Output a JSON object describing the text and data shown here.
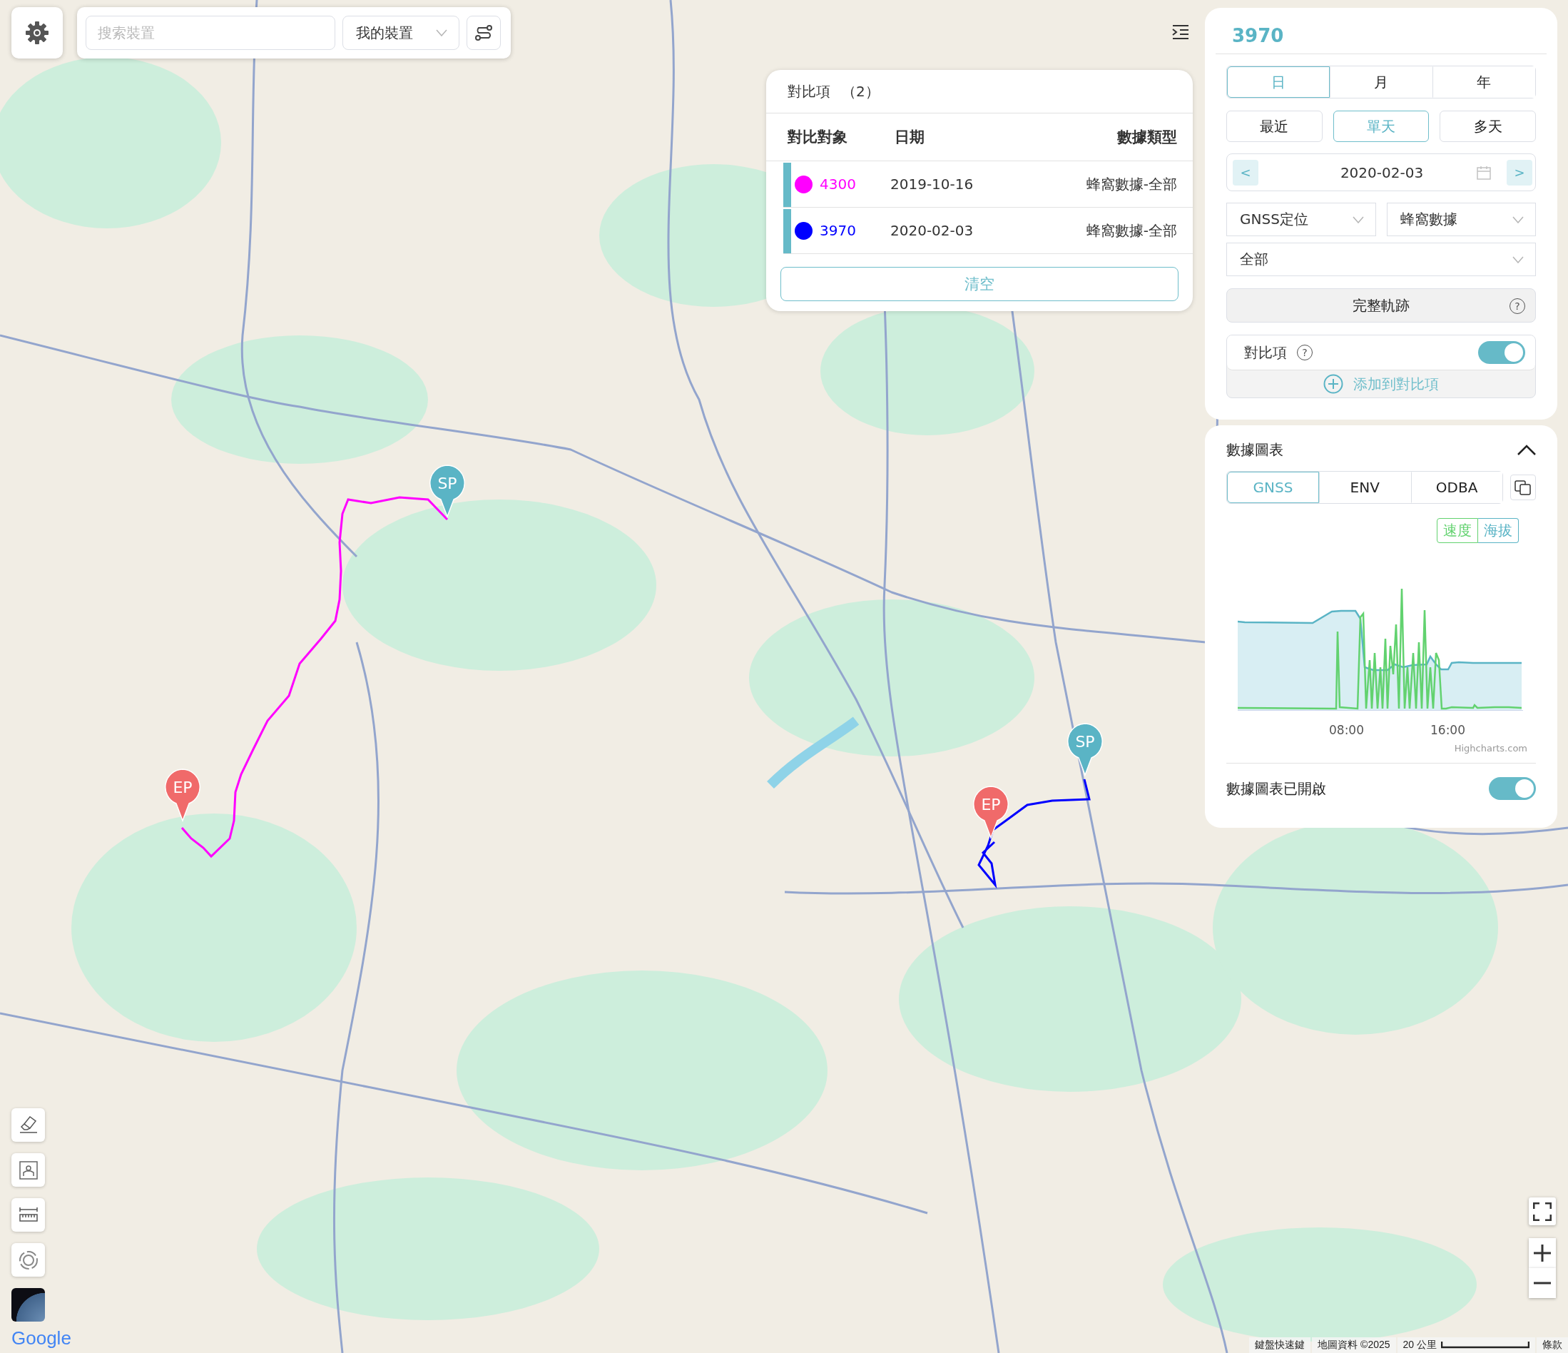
{
  "toolbar": {
    "search": {
      "placeholder": "搜索裝置"
    },
    "device_filter": {
      "value": "我的裝置"
    }
  },
  "compare_panel": {
    "title": "對比項",
    "count": "（2）",
    "columns": [
      "對比對象",
      "日期",
      "數據類型"
    ],
    "rows": [
      {
        "name": "4300",
        "color": "#ff00ff",
        "date": "2019-10-16",
        "data_type": "蜂窩數據-全部"
      },
      {
        "name": "3970",
        "color": "#0000ff",
        "date": "2020-02-03",
        "data_type": "蜂窩數據-全部"
      }
    ],
    "clear_button": "清空"
  },
  "device_panel": {
    "title": "3970",
    "period_tabs": [
      {
        "label": "日",
        "selected": true
      },
      {
        "label": "月",
        "selected": false
      },
      {
        "label": "年",
        "selected": false
      }
    ],
    "range_tabs": [
      {
        "label": "最近",
        "selected": false
      },
      {
        "label": "單天",
        "selected": true
      },
      {
        "label": "多天",
        "selected": false
      }
    ],
    "date": {
      "prev": "<",
      "value": "2020-02-03",
      "next": ">"
    },
    "selects": [
      {
        "value": "GNSS定位"
      },
      {
        "value": "蜂窩數據"
      },
      {
        "value": "全部"
      }
    ],
    "full_track": {
      "label": "完整軌跡",
      "help": "?"
    },
    "compare": {
      "label": "對比項",
      "help": "?",
      "on": true
    },
    "add_compare": "添加到對比項"
  },
  "chart_panel": {
    "title": "數據圖表",
    "expanded": true,
    "tabs": [
      {
        "label": "GNSS",
        "selected": true
      },
      {
        "label": "ENV",
        "selected": false
      },
      {
        "label": "ODBA",
        "selected": false
      }
    ],
    "series": [
      {
        "label": "速度",
        "color": "#62d26f"
      },
      {
        "label": "海拔",
        "color": "#5ab4c5"
      }
    ],
    "x_labels": [
      "08:00",
      "16:00"
    ],
    "credit": "Highcharts.com",
    "footer": {
      "label": "數據圖表已開啟",
      "on": true
    }
  },
  "map": {
    "tracks": [
      {
        "color": "#ff00ff",
        "start": "SP",
        "end": "EP"
      },
      {
        "color": "#0000ff",
        "start": "SP",
        "end": "EP"
      }
    ],
    "logo": "Google",
    "attribution": [
      "鍵盤快速鍵",
      "地圖資料 ©2025"
    ],
    "scale": "20 公里",
    "terms": "條款"
  }
}
